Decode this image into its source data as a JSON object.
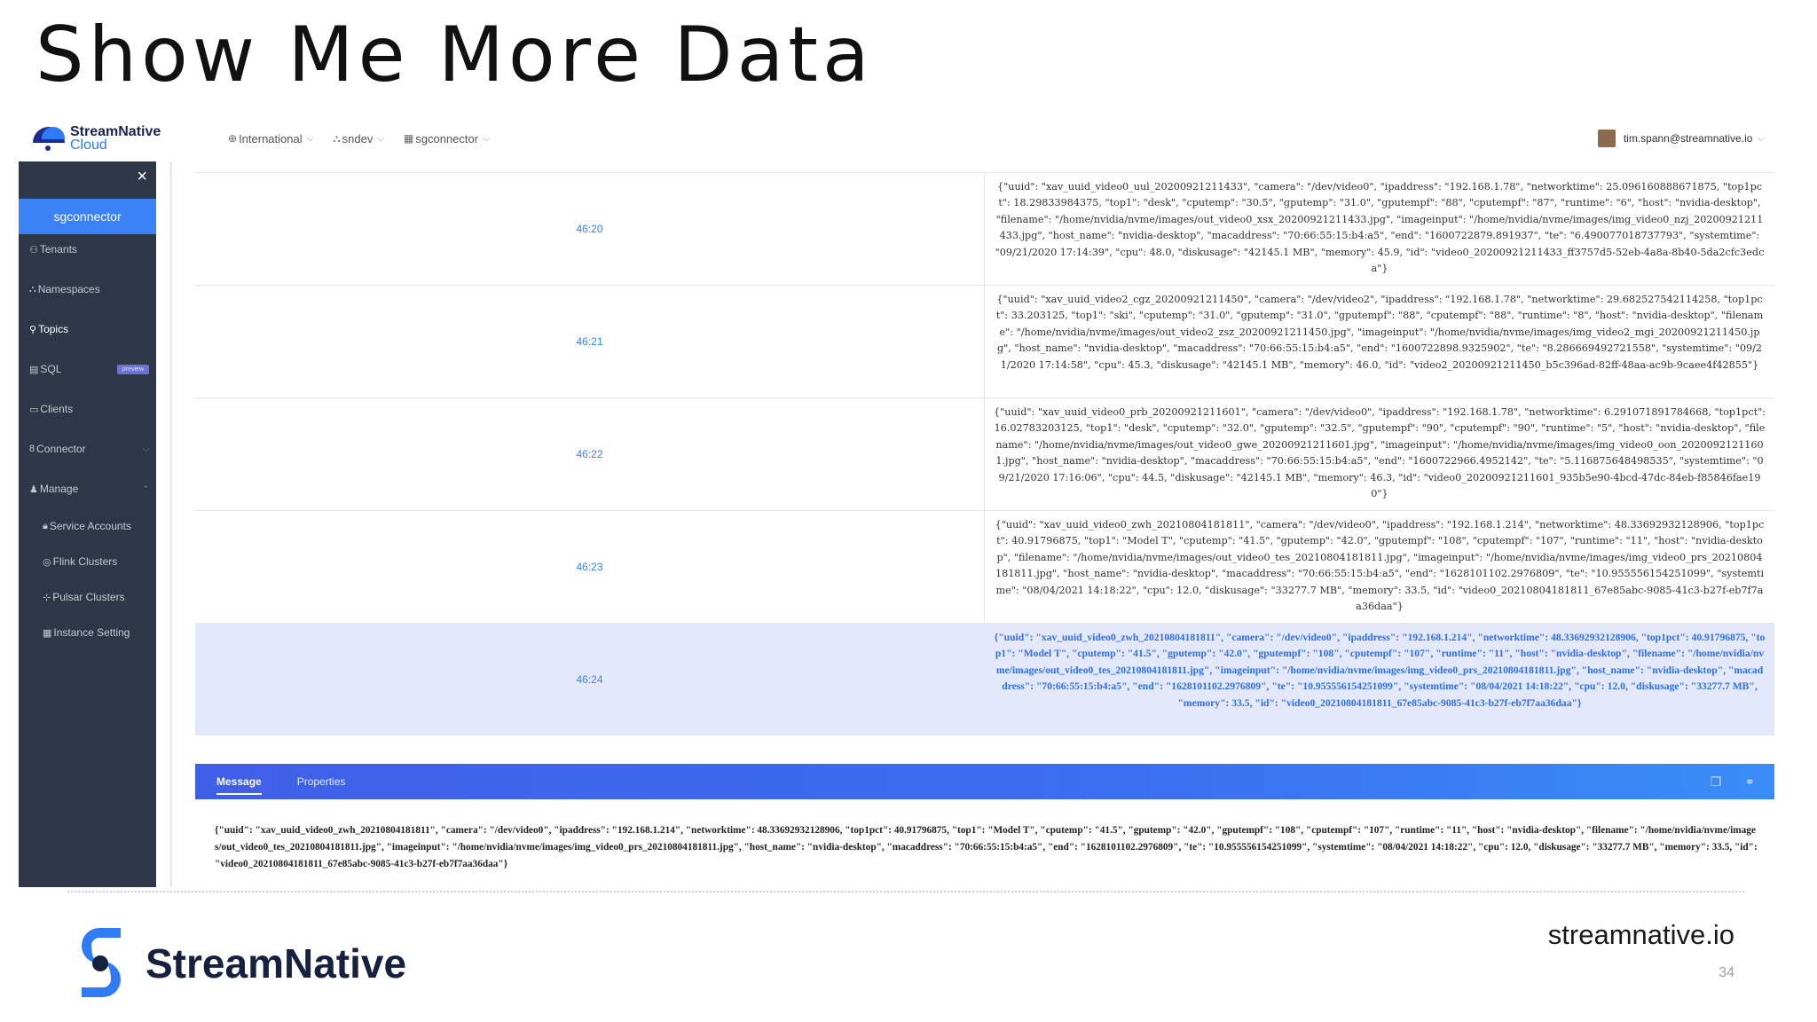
{
  "slide": {
    "title": "Show Me More Data",
    "footer_brand": "StreamNative",
    "footer_url": "streamnative.io",
    "page_number": "34"
  },
  "topbar": {
    "brand_line1": "StreamNative",
    "brand_line2": "Cloud",
    "org": "International",
    "instance": "sndev",
    "cluster": "sgconnector",
    "user": "tim.spann@streamnative.io"
  },
  "sidebar": {
    "active": "sgconnector",
    "items": [
      {
        "icon": "tenant-icon",
        "glyph": "⚇",
        "label": "Tenants"
      },
      {
        "icon": "namespace-icon",
        "glyph": "⛬",
        "label": "Namespaces"
      },
      {
        "icon": "topic-icon",
        "glyph": "⚲",
        "label": "Topics"
      },
      {
        "icon": "sql-icon",
        "glyph": "▤",
        "label": "SQL",
        "badge": "preview"
      },
      {
        "icon": "clients-icon",
        "glyph": "▭",
        "label": "Clients"
      },
      {
        "icon": "connector-icon",
        "glyph": "8",
        "label": "Connector"
      },
      {
        "icon": "manage-icon",
        "glyph": "♟",
        "label": "Manage"
      },
      {
        "icon": "lock-icon",
        "glyph": "🔒︎",
        "label": "Service Accounts"
      },
      {
        "icon": "flink-icon",
        "glyph": "◎",
        "label": "Flink Clusters"
      },
      {
        "icon": "pulsar-icon",
        "glyph": "⊹",
        "label": "Pulsar Clusters"
      },
      {
        "icon": "instance-icon",
        "glyph": "▦",
        "label": "Instance Setting"
      }
    ]
  },
  "messages": {
    "rows": [
      {
        "time": "46:20",
        "text": "{\"uuid\": \"xav_uuid_video0_uul_20200921211433\", \"camera\": \"/dev/video0\", \"ipaddress\": \"192.168.1.78\", \"networktime\": 25.096160888671875, \"top1pct\": 18.29833984375, \"top1\": \"desk\", \"cputemp\": \"30.5\", \"gputemp\": \"31.0\", \"gputempf\": \"88\", \"cputempf\": \"87\", \"runtime\": \"6\", \"host\": \"nvidia-desktop\", \"filename\": \"/home/nvidia/nvme/images/out_video0_xsx_20200921211433.jpg\", \"imageinput\": \"/home/nvidia/nvme/images/img_video0_nzj_20200921211433.jpg\", \"host_name\": \"nvidia-desktop\", \"macaddress\": \"70:66:55:15:b4:a5\", \"end\": \"1600722879.891937\", \"te\": \"6.490077018737793\", \"systemtime\": \"09/21/2020 17:14:39\", \"cpu\": 48.0, \"diskusage\": \"42145.1 MB\", \"memory\": 45.9, \"id\": \"video0_20200921211433_ff3757d5-52eb-4a8a-8b40-5da2cfc3edca\"}"
      },
      {
        "time": "46:21",
        "text": "{\"uuid\": \"xav_uuid_video2_cgz_20200921211450\", \"camera\": \"/dev/video2\", \"ipaddress\": \"192.168.1.78\", \"networktime\": 29.682527542114258, \"top1pct\": 33.203125, \"top1\": \"ski\", \"cputemp\": \"31.0\", \"gputemp\": \"31.0\", \"gputempf\": \"88\", \"cputempf\": \"88\", \"runtime\": \"8\", \"host\": \"nvidia-desktop\", \"filename\": \"/home/nvidia/nvme/images/out_video2_zsz_20200921211450.jpg\", \"imageinput\": \"/home/nvidia/nvme/images/img_video2_mgi_20200921211450.jpg\", \"host_name\": \"nvidia-desktop\", \"macaddress\": \"70:66:55:15:b4:a5\", \"end\": \"1600722898.9325902\", \"te\": \"8.286669492721558\", \"systemtime\": \"09/21/2020 17:14:58\", \"cpu\": 45.3, \"diskusage\": \"42145.1 MB\", \"memory\": 46.0, \"id\": \"video2_20200921211450_b5c396ad-82ff-48aa-ac9b-9caee4f42855\"}"
      },
      {
        "time": "46:22",
        "text": "{\"uuid\": \"xav_uuid_video0_prb_20200921211601\", \"camera\": \"/dev/video0\", \"ipaddress\": \"192.168.1.78\", \"networktime\": 6.291071891784668, \"top1pct\": 16.02783203125, \"top1\": \"desk\", \"cputemp\": \"32.0\", \"gputemp\": \"32.5\", \"gputempf\": \"90\", \"cputempf\": \"90\", \"runtime\": \"5\", \"host\": \"nvidia-desktop\", \"filename\": \"/home/nvidia/nvme/images/out_video0_gwe_20200921211601.jpg\", \"imageinput\": \"/home/nvidia/nvme/images/img_video0_oon_20200921211601.jpg\", \"host_name\": \"nvidia-desktop\", \"macaddress\": \"70:66:55:15:b4:a5\", \"end\": \"1600722966.4952142\", \"te\": \"5.116875648498535\", \"systemtime\": \"09/21/2020 17:16:06\", \"cpu\": 44.5, \"diskusage\": \"42145.1 MB\", \"memory\": 46.3, \"id\": \"video0_20200921211601_935b5e90-4bcd-47dc-84eb-f85846fae190\"}"
      },
      {
        "time": "46:23",
        "text": "{\"uuid\": \"xav_uuid_video0_zwh_20210804181811\", \"camera\": \"/dev/video0\", \"ipaddress\": \"192.168.1.214\", \"networktime\": 48.33692932128906, \"top1pct\": 40.91796875, \"top1\": \"Model T\", \"cputemp\": \"41.5\", \"gputemp\": \"42.0\", \"gputempf\": \"108\", \"cputempf\": \"107\", \"runtime\": \"11\", \"host\": \"nvidia-desktop\", \"filename\": \"/home/nvidia/nvme/images/out_video0_tes_20210804181811.jpg\", \"imageinput\": \"/home/nvidia/nvme/images/img_video0_prs_20210804181811.jpg\", \"host_name\": \"nvidia-desktop\", \"macaddress\": \"70:66:55:15:b4:a5\", \"end\": \"1628101102.2976809\", \"te\": \"10.955556154251099\", \"systemtime\": \"08/04/2021 14:18:22\", \"cpu\": 12.0, \"diskusage\": \"33277.7 MB\", \"memory\": 33.5, \"id\": \"video0_20210804181811_67e85abc-9085-41c3-b27f-eb7f7aa36daa\"}"
      },
      {
        "time": "46:24",
        "text": "{\"uuid\": \"xav_uuid_video0_zwh_20210804181811\", \"camera\": \"/dev/video0\", \"ipaddress\": \"192.168.1.214\", \"networktime\": 48.33692932128906, \"top1pct\": 40.91796875, \"top1\": \"Model T\", \"cputemp\": \"41.5\", \"gputemp\": \"42.0\", \"gputempf\": \"108\", \"cputempf\": \"107\", \"runtime\": \"11\", \"host\": \"nvidia-desktop\", \"filename\": \"/home/nvidia/nvme/images/out_video0_tes_20210804181811.jpg\", \"imageinput\": \"/home/nvidia/nvme/images/img_video0_prs_20210804181811.jpg\", \"host_name\": \"nvidia-desktop\", \"macaddress\": \"70:66:55:15:b4:a5\", \"end\": \"1628101102.2976809\", \"te\": \"10.955556154251099\", \"systemtime\": \"08/04/2021 14:18:22\", \"cpu\": 12.0, \"diskusage\": \"33277.7 MB\", \"memory\": 33.5, \"id\": \"video0_20210804181811_67e85abc-9085-41c3-b27f-eb7f7aa36daa\"}"
      }
    ]
  },
  "detail": {
    "tab_message": "Message",
    "tab_properties": "Properties",
    "body": "{\"uuid\": \"xav_uuid_video0_zwh_20210804181811\", \"camera\": \"/dev/video0\", \"ipaddress\": \"192.168.1.214\", \"networktime\": 48.33692932128906, \"top1pct\": 40.91796875, \"top1\": \"Model T\", \"cputemp\": \"41.5\", \"gputemp\": \"42.0\", \"gputempf\": \"108\", \"cputempf\": \"107\", \"runtime\": \"11\", \"host\": \"nvidia-desktop\", \"filename\": \"/home/nvidia/nvme/images/out_video0_tes_20210804181811.jpg\", \"imageinput\": \"/home/nvidia/nvme/images/img_video0_prs_20210804181811.jpg\", \"host_name\": \"nvidia-desktop\", \"macaddress\": \"70:66:55:15:b4:a5\", \"end\": \"1628101102.2976809\", \"te\": \"10.955556154251099\", \"systemtime\": \"08/04/2021 14:18:22\", \"cpu\": 12.0, \"diskusage\": \"33277.7 MB\", \"memory\": 33.5, \"id\": \"video0_20210804181811_67e85abc-9085-41c3-b27f-eb7f7aa36daa\"}"
  },
  "colors": {
    "accent": "#3b82f6",
    "sidebar_bg": "#2d3748",
    "selected_row": "#e3e9fb"
  }
}
